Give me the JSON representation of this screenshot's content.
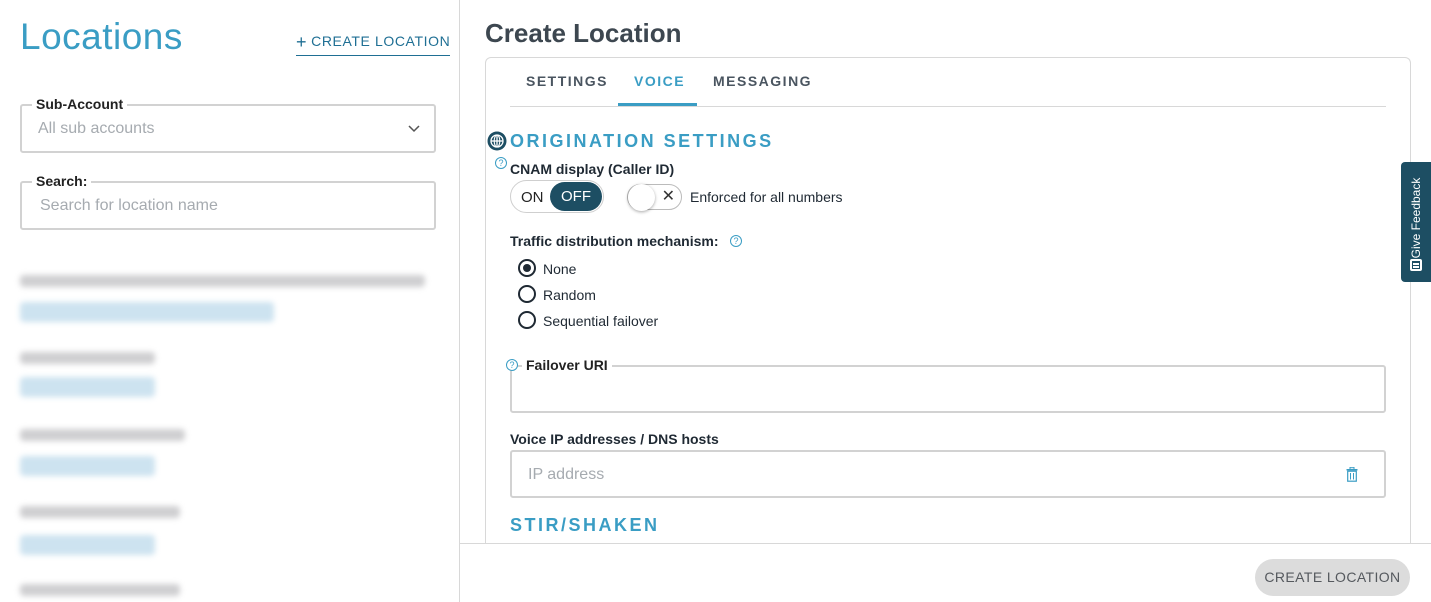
{
  "left": {
    "title": "Locations",
    "create_link": "CREATE LOCATION",
    "sub_account": {
      "label": "Sub-Account",
      "placeholder": "All sub accounts"
    },
    "search": {
      "label": "Search:",
      "placeholder": "Search for location name"
    }
  },
  "right": {
    "title": "Create Location",
    "tabs": [
      {
        "label": "SETTINGS"
      },
      {
        "label": "VOICE"
      },
      {
        "label": "MESSAGING"
      }
    ],
    "active_tab": "VOICE",
    "origination": {
      "heading": "ORIGINATION SETTINGS",
      "cnam_label": "CNAM display (Caller ID)",
      "toggle_on": "ON",
      "toggle_off": "OFF",
      "enforced_label": "Enforced for all numbers",
      "traffic_label": "Traffic distribution mechanism:",
      "radios": [
        {
          "label": "None",
          "selected": true
        },
        {
          "label": "Random",
          "selected": false
        },
        {
          "label": "Sequential failover",
          "selected": false
        }
      ],
      "failover_label": "Failover URI",
      "voice_ip_label": "Voice IP addresses / DNS hosts",
      "ip_placeholder": "IP address"
    },
    "stir_heading": "STIR/SHAKEN",
    "create_button": "CREATE LOCATION"
  },
  "feedback": {
    "label": "Give Feedback"
  },
  "colors": {
    "accent": "#3a9dc4",
    "dark_teal": "#1d4e63",
    "button_disabled_bg": "#dcdcdc"
  }
}
